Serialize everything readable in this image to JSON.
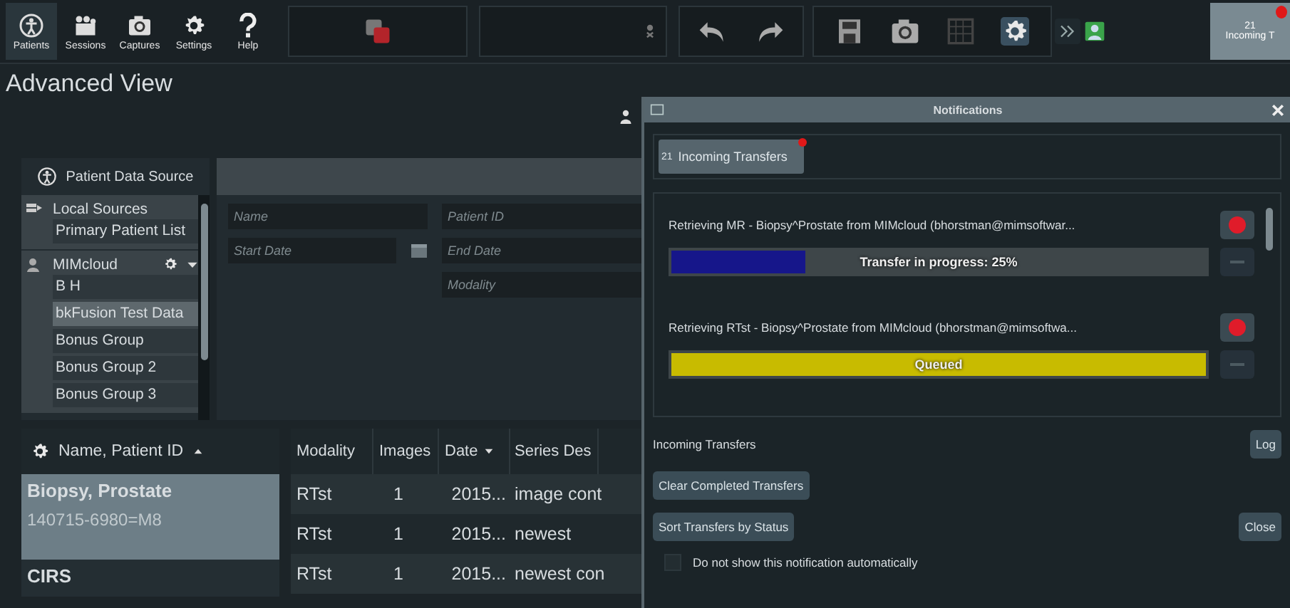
{
  "toolbar": {
    "buttons": [
      {
        "label": "Patients",
        "kind": "patients",
        "selected": true
      },
      {
        "label": "Sessions",
        "kind": "sessions",
        "selected": false
      },
      {
        "label": "Captures",
        "kind": "captures",
        "selected": false
      },
      {
        "label": "Settings",
        "kind": "settings",
        "selected": false
      },
      {
        "label": "Help",
        "kind": "help",
        "selected": false
      }
    ],
    "notification_tab": {
      "count": "21",
      "label": "Incoming T"
    }
  },
  "view_title": "Advanced View",
  "data_source": {
    "title": "Patient Data Source",
    "groups": [
      {
        "name": "Local Sources",
        "kind": "local",
        "items": [
          {
            "label": "Primary Patient List",
            "selected": false
          }
        ]
      },
      {
        "name": "MIMcloud",
        "kind": "cloud",
        "items": [
          {
            "label": "B H",
            "selected": false
          },
          {
            "label": "bkFusion Test Data",
            "selected": true
          },
          {
            "label": "Bonus Group",
            "selected": false
          },
          {
            "label": "Bonus Group 2",
            "selected": false
          },
          {
            "label": "Bonus Group 3",
            "selected": false
          }
        ]
      }
    ]
  },
  "search": {
    "columns": [
      [
        {
          "placeholder": "Name"
        },
        {
          "placeholder": "Start Date",
          "calendar": true
        }
      ],
      [
        {
          "placeholder": "Patient ID"
        },
        {
          "placeholder": "End Date"
        },
        {
          "placeholder": "Modality"
        }
      ]
    ]
  },
  "patients": {
    "header": {
      "label": "Name, Patient ID",
      "sort_descending": false
    },
    "rows": [
      {
        "name": "Biopsy, Prostate",
        "id": "140715-6980=M8",
        "selected": true
      },
      {
        "name": "CIRS",
        "selected": false
      }
    ]
  },
  "series": {
    "columns": [
      {
        "label": "Modality"
      },
      {
        "label": "Images"
      },
      {
        "label": "Date",
        "sort_descending": true
      },
      {
        "label": "Series Des"
      }
    ],
    "rows": [
      [
        "RTst",
        "1",
        "2015...",
        "image cont"
      ],
      [
        "RTst",
        "1",
        "2015...",
        "newest"
      ],
      [
        "RTst",
        "1",
        "2015...",
        "newest con"
      ]
    ]
  },
  "notifications": {
    "title": "Notifications",
    "tab": {
      "count": "21",
      "label": "Incoming Transfers",
      "selected": true
    },
    "transfers": [
      {
        "text": "Retrieving MR - Biopsy^Prostate from MIMcloud (bhorstman@mimsoftwar...",
        "progress": {
          "label": "Transfer in progress: 25%",
          "level": 0.25,
          "color": "#16168a"
        }
      },
      {
        "text": "Retrieving RTst - Biopsy^Prostate from MIMcloud (bhorstman@mimsoftwa...",
        "progress": {
          "label": "Queued",
          "level": 1,
          "color": "#c8bb00"
        }
      }
    ],
    "section_label": "Incoming Transfers",
    "log_button": "Log",
    "clear_button": "Clear Completed Transfers",
    "sort_button": "Sort Transfers by Status",
    "close_button": "Close",
    "checkbox": {
      "label": "Do not show this notification automatically",
      "checked": false
    }
  }
}
